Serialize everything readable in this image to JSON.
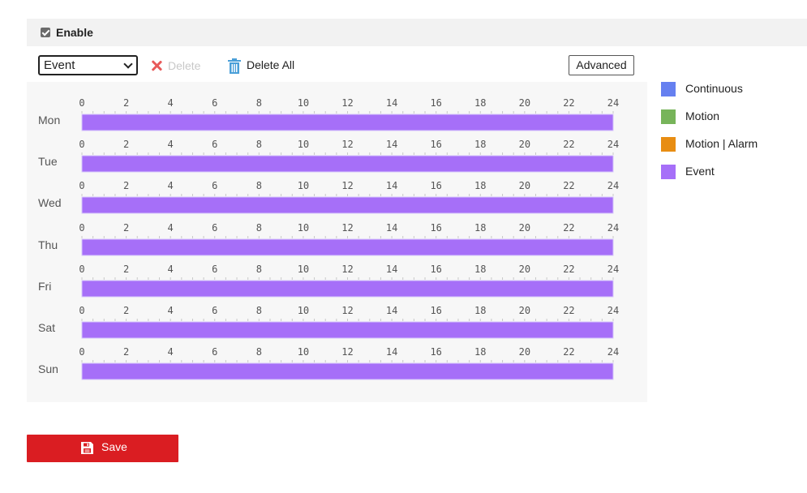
{
  "enable": {
    "label": "Enable",
    "checked": true
  },
  "toolbar": {
    "mode_select": {
      "selected": "Event"
    },
    "delete_label": "Delete",
    "delete_all_label": "Delete All",
    "advanced_label": "Advanced"
  },
  "schedule": {
    "hour_ticks": [
      "0",
      "2",
      "4",
      "6",
      "8",
      "10",
      "12",
      "14",
      "16",
      "18",
      "20",
      "22",
      "24"
    ],
    "days": [
      {
        "label": "Mon",
        "type": "Event",
        "start": 0,
        "end": 24
      },
      {
        "label": "Tue",
        "type": "Event",
        "start": 0,
        "end": 24
      },
      {
        "label": "Wed",
        "type": "Event",
        "start": 0,
        "end": 24
      },
      {
        "label": "Thu",
        "type": "Event",
        "start": 0,
        "end": 24
      },
      {
        "label": "Fri",
        "type": "Event",
        "start": 0,
        "end": 24
      },
      {
        "label": "Sat",
        "type": "Event",
        "start": 0,
        "end": 24
      },
      {
        "label": "Sun",
        "type": "Event",
        "start": 0,
        "end": 24
      }
    ]
  },
  "legend": {
    "items": [
      {
        "label": "Continuous",
        "color": "#6680f0"
      },
      {
        "label": "Motion",
        "color": "#77b45a"
      },
      {
        "label": "Motion | Alarm",
        "color": "#e88d12"
      },
      {
        "label": "Event",
        "color": "#a66ff8"
      }
    ]
  },
  "save": {
    "label": "Save"
  },
  "colors": {
    "accent": "#da1d22",
    "tick": "#c8c8c8",
    "bar_border": "#d6c5fb"
  }
}
